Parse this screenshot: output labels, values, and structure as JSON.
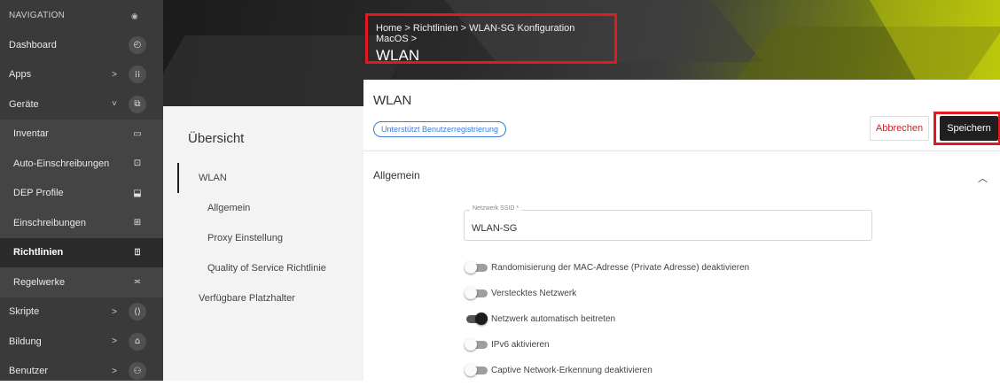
{
  "sidebar": {
    "title": "NAVIGATION",
    "items": [
      {
        "label": "Dashboard",
        "icon": "dashboard-gauge-icon",
        "glyph": "◴",
        "chevron": ""
      },
      {
        "label": "Apps",
        "icon": "apps-grid-icon",
        "glyph": "⁞⁞",
        "chevron": ">"
      },
      {
        "label": "Geräte",
        "icon": "devices-icon",
        "glyph": "⧉",
        "chevron": "˅"
      },
      {
        "label": "Inventar",
        "icon": "inventory-icon",
        "glyph": "▭",
        "chevron": ""
      },
      {
        "label": "Auto-Einschreibungen",
        "icon": "auto-enroll-icon",
        "glyph": "⊡",
        "chevron": ""
      },
      {
        "label": "DEP Profile",
        "icon": "dep-profile-icon",
        "glyph": "⬓",
        "chevron": ""
      },
      {
        "label": "Einschreibungen",
        "icon": "enrollments-icon",
        "glyph": "⊞",
        "chevron": ""
      },
      {
        "label": "Richtlinien",
        "icon": "policies-icon",
        "glyph": "⍐",
        "chevron": ""
      },
      {
        "label": "Regelwerke",
        "icon": "rulesets-icon",
        "glyph": "≍",
        "chevron": ""
      },
      {
        "label": "Skripte",
        "icon": "scripts-icon",
        "glyph": "⟨⟩",
        "chevron": ">"
      },
      {
        "label": "Bildung",
        "icon": "education-icon",
        "glyph": "⌂",
        "chevron": ">"
      },
      {
        "label": "Benutzer",
        "icon": "users-icon",
        "glyph": "⚇",
        "chevron": ">"
      }
    ]
  },
  "header": {
    "breadcrumb": "Home > Richtlinien > WLAN-SG Konfiguration MacOS >",
    "title": "WLAN"
  },
  "overview": {
    "title": "Übersicht",
    "items": [
      "WLAN",
      "Allgemein",
      "Proxy Einstellung",
      "Quality of Service Richtlinie",
      "Verfügbare Platzhalter"
    ]
  },
  "card": {
    "title": "WLAN",
    "badge": "Unterstützt Benutzerregistrierung",
    "cancel_label": "Abbrechen",
    "save_label": "Speichern",
    "section_title": "Allgemein",
    "ssid": {
      "label": "Netzwerk SSID *",
      "value": "WLAN-SG"
    },
    "toggles": [
      {
        "label": "Randomisierung der MAC-Adresse (Private Adresse) deaktivieren",
        "on": false
      },
      {
        "label": "Verstecktes Netzwerk",
        "on": false
      },
      {
        "label": "Netzwerk automatisch beitreten",
        "on": true
      },
      {
        "label": "IPv6 aktivieren",
        "on": false
      },
      {
        "label": "Captive Network-Erkennung deaktivieren",
        "on": false
      }
    ]
  },
  "colors": {
    "highlight_red": "#e01a22",
    "accent_blue": "#3d7bd6",
    "cancel_red": "#c62828",
    "sidebar_bg": "#3a3a3a"
  }
}
